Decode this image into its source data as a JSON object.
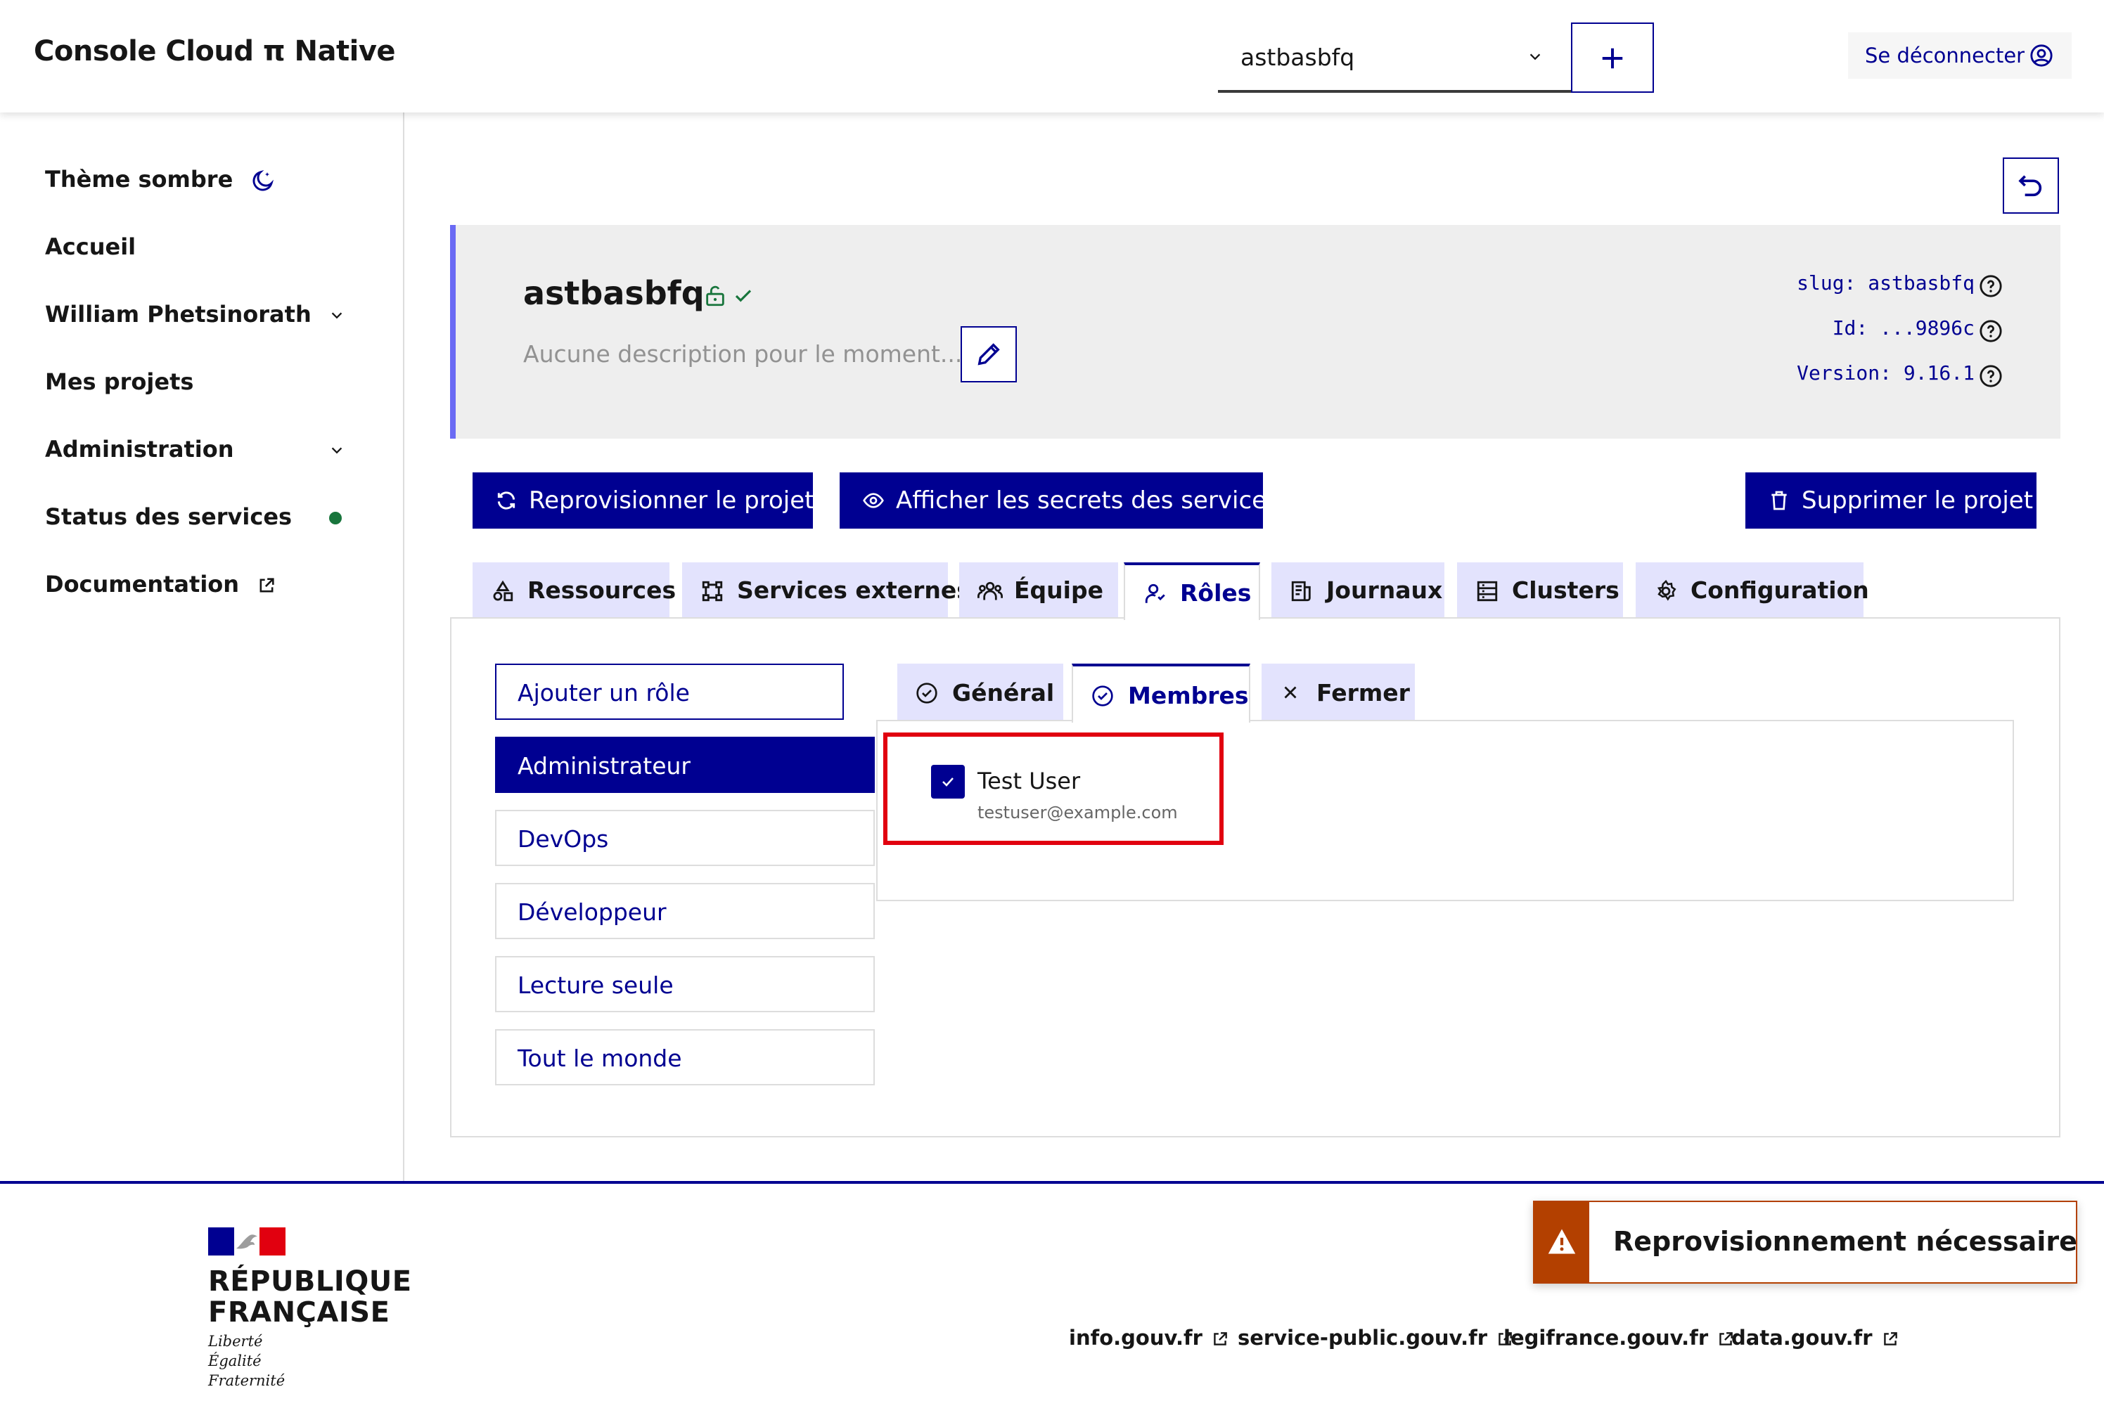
{
  "header": {
    "app_title": "Console Cloud π Native",
    "project_select": {
      "value": "astbasbfq"
    },
    "add_label": "+",
    "logout_label": "Se déconnecter"
  },
  "sidebar": {
    "items": [
      {
        "label": "Thème sombre",
        "icon": "moon-icon"
      },
      {
        "label": "Accueil"
      },
      {
        "label": "William Phetsinorath",
        "icon": "chevron-down-icon"
      },
      {
        "label": "Mes projets"
      },
      {
        "label": "Administration",
        "icon": "chevron-down-icon"
      },
      {
        "label": "Status des services",
        "status_color": "#18753c"
      },
      {
        "label": "Documentation",
        "icon": "external-link-icon"
      }
    ]
  },
  "project": {
    "name": "astbasbfq",
    "description": "Aucune description pour le moment...",
    "meta": {
      "slug": "slug: astbasbfq",
      "id": "Id: ...9896c",
      "version": "Version: 9.16.1"
    }
  },
  "actions": {
    "reprovision": "Reprovisionner le projet",
    "secrets": "Afficher les secrets des services",
    "delete": "Supprimer le projet"
  },
  "tabs": [
    {
      "label": "Ressources",
      "icon": "resources-icon"
    },
    {
      "label": "Services externes",
      "icon": "services-icon"
    },
    {
      "label": "Équipe",
      "icon": "team-icon"
    },
    {
      "label": "Rôles",
      "icon": "user-icon",
      "active": true
    },
    {
      "label": "Journaux",
      "icon": "logs-icon"
    },
    {
      "label": "Clusters",
      "icon": "clusters-icon"
    },
    {
      "label": "Configuration",
      "icon": "gear-icon"
    }
  ],
  "roles": {
    "add_label": "Ajouter un rôle",
    "items": [
      "Administrateur",
      "DevOps",
      "Développeur",
      "Lecture seule",
      "Tout le monde"
    ],
    "selected": "Administrateur"
  },
  "role_tabs": [
    {
      "label": "Général",
      "icon": "check-circle-icon"
    },
    {
      "label": "Membres",
      "icon": "check-circle-icon",
      "active": true
    },
    {
      "label": "Fermer",
      "icon": "close-icon"
    }
  ],
  "members": [
    {
      "name": "Test User",
      "email": "testuser@example.com",
      "checked": true
    }
  ],
  "footer": {
    "republique_l1": "RÉPUBLIQUE",
    "republique_l2": "FRANÇAISE",
    "motto": [
      "Liberté",
      "Égalité",
      "Fraternité"
    ],
    "links": [
      "info.gouv.fr",
      "service-public.gouv.fr",
      "legifrance.gouv.fr",
      "data.gouv.fr"
    ]
  },
  "toast": {
    "message": "Reprovisionnement nécessaire",
    "color": "#b34000"
  },
  "colors": {
    "primary": "#000091",
    "tab_bg": "#e3e3fd",
    "card_bg": "#eeeeee",
    "highlight": "#e1000f"
  }
}
